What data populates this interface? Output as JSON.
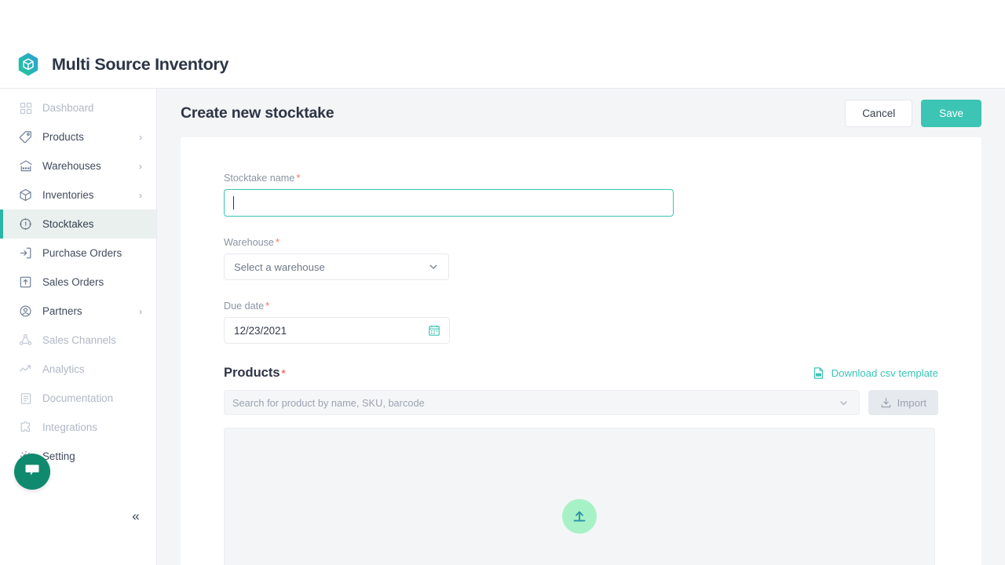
{
  "brand": {
    "title": "Multi Source Inventory",
    "logo_icon": "cube-hexagon-logo",
    "accent": "#3cc4b5"
  },
  "sidebar": {
    "items": [
      {
        "label": "Dashboard",
        "icon": "grid-icon",
        "state": "muted",
        "chevron": ""
      },
      {
        "label": "Products",
        "icon": "tag-icon",
        "state": "normal",
        "chevron": "›"
      },
      {
        "label": "Warehouses",
        "icon": "warehouse-icon",
        "state": "normal",
        "chevron": "›"
      },
      {
        "label": "Inventories",
        "icon": "box-icon",
        "state": "normal",
        "chevron": "›"
      },
      {
        "label": "Stocktakes",
        "icon": "stocktake-icon",
        "state": "active",
        "chevron": ""
      },
      {
        "label": "Purchase Orders",
        "icon": "login-arrow-icon",
        "state": "normal",
        "chevron": ""
      },
      {
        "label": "Sales Orders",
        "icon": "upload-box-icon",
        "state": "normal",
        "chevron": ""
      },
      {
        "label": "Partners",
        "icon": "user-circle-icon",
        "state": "normal",
        "chevron": "›"
      },
      {
        "label": "Sales Channels",
        "icon": "share-nodes-icon",
        "state": "muted",
        "chevron": ""
      },
      {
        "label": "Analytics",
        "icon": "trend-up-icon",
        "state": "muted",
        "chevron": ""
      },
      {
        "label": "Documentation",
        "icon": "document-icon",
        "state": "muted",
        "chevron": ""
      },
      {
        "label": "Integrations",
        "icon": "puzzle-icon",
        "state": "muted",
        "chevron": ""
      },
      {
        "label": "Setting",
        "icon": "gear-icon",
        "state": "normal",
        "chevron": ""
      }
    ],
    "collapse_glyph": "«",
    "chat_icon": "chat-bubble-icon"
  },
  "page": {
    "title": "Create new stocktake",
    "cancel_label": "Cancel",
    "save_label": "Save"
  },
  "form": {
    "stocktake_name": {
      "label": "Stocktake name",
      "required_mark": "*",
      "value": "",
      "placeholder": ""
    },
    "warehouse": {
      "label": "Warehouse",
      "required_mark": "*",
      "selected": "Select a warehouse",
      "chevron_icon": "chevron-down-icon"
    },
    "due_date": {
      "label": "Due date",
      "required_mark": "*",
      "value": "12/23/2021",
      "calendar_icon": "calendar-icon"
    },
    "products": {
      "title": "Products",
      "required_mark": "*",
      "download_csv_label": "Download csv template",
      "csv_icon": "csv-file-icon",
      "search_placeholder": "Search for product by name, SKU, barcode",
      "search_chevron_icon": "chevron-down-icon",
      "import_label": "Import",
      "import_icon": "import-upload-icon",
      "dropzone_icon": "upload-circle-icon"
    }
  }
}
